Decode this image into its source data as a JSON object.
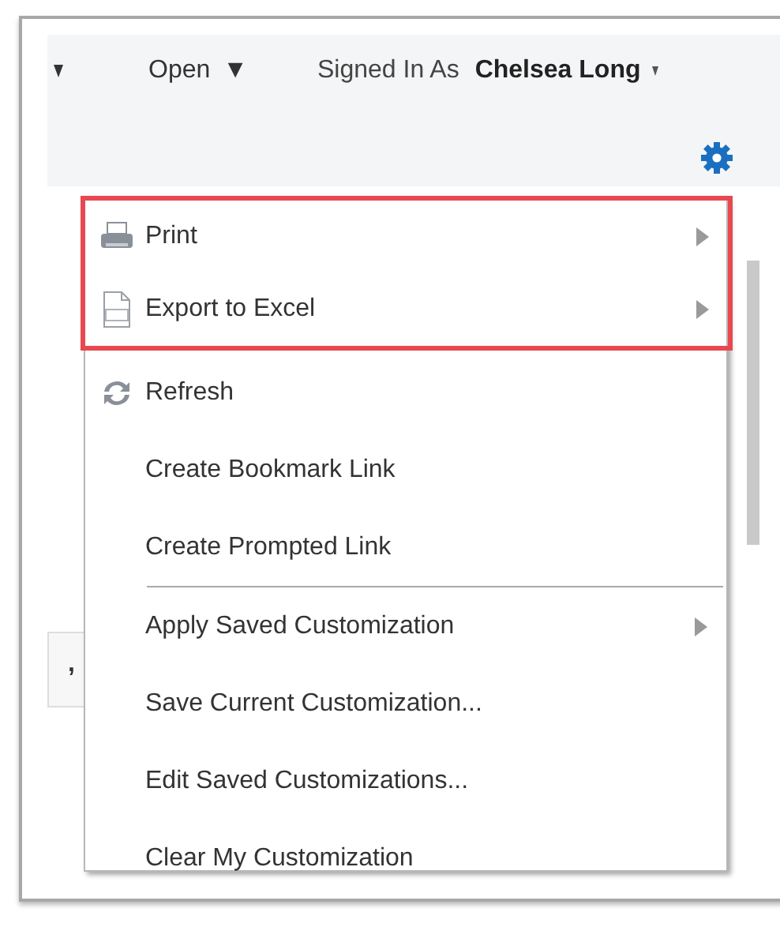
{
  "header": {
    "open_label": "Open",
    "open_caret": "▼",
    "signed_in_label": "Signed In As",
    "user_name": "Chelsea Long"
  },
  "background": {
    "cell_text": ","
  },
  "menu": [
    {
      "kind": "printer",
      "label": "Print",
      "submenu": true,
      "highlighted": true
    },
    {
      "kind": "spreadsheet",
      "label": "Export to Excel",
      "submenu": true,
      "highlighted": true
    },
    {
      "kind": "refresh",
      "label": "Refresh",
      "submenu": false,
      "highlighted": false
    },
    {
      "kind": "text",
      "label": "Create Bookmark Link",
      "submenu": false,
      "highlighted": false
    },
    {
      "kind": "text",
      "label": "Create Prompted Link",
      "submenu": false,
      "highlighted": false
    },
    {
      "kind": "separator"
    },
    {
      "kind": "text",
      "label": "Apply Saved Customization",
      "submenu": true,
      "highlighted": false
    },
    {
      "kind": "text",
      "label": "Save Current Customization...",
      "submenu": false,
      "highlighted": false
    },
    {
      "kind": "text",
      "label": "Edit Saved Customizations...",
      "submenu": false,
      "highlighted": false
    },
    {
      "kind": "text",
      "label": "Clear My Customization",
      "submenu": false,
      "highlighted": false
    }
  ]
}
